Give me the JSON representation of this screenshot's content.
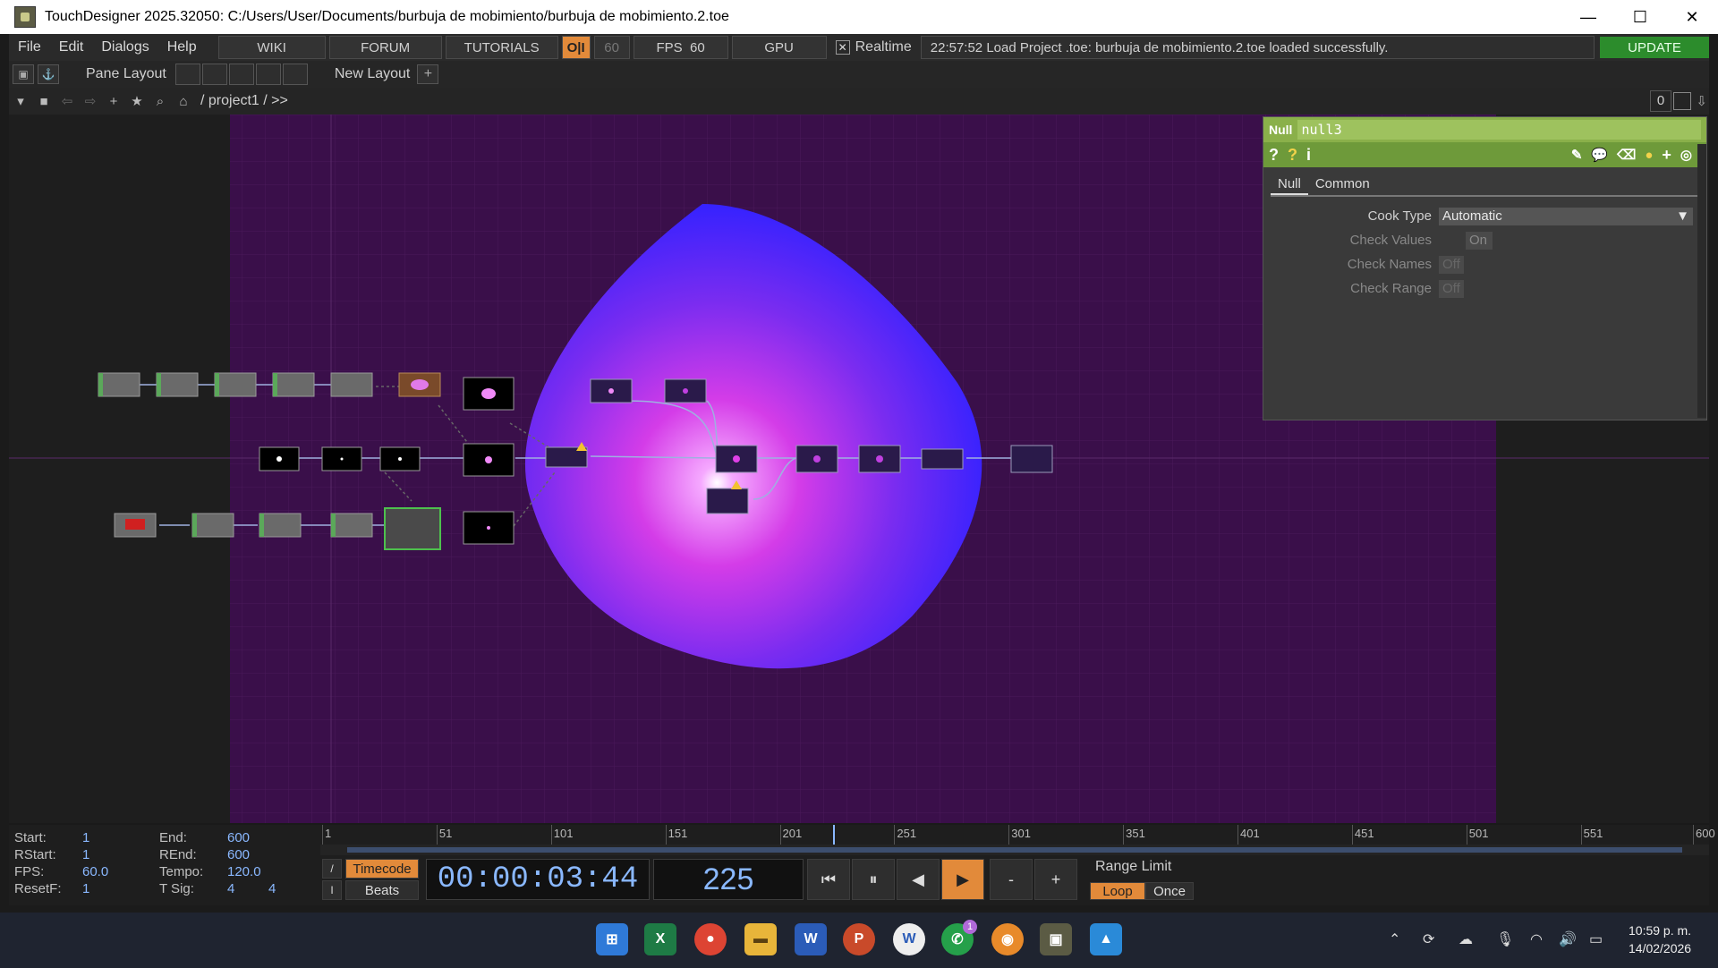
{
  "window": {
    "title": "TouchDesigner 2025.32050: C:/Users/User/Documents/burbuja de mobimiento/burbuja de mobimiento.2.toe",
    "minimize": "—",
    "maximize": "☐",
    "close": "✕"
  },
  "menu": {
    "items": [
      "File",
      "Edit",
      "Dialogs",
      "Help"
    ],
    "wiki": "WIKI",
    "forum": "FORUM",
    "tutorials": "TUTORIALS",
    "oi": "O|I",
    "fps_cap": "60",
    "fps_label": "FPS",
    "fps_value": "60",
    "gpu": "GPU",
    "realtime_check": "✕",
    "realtime": "Realtime",
    "status": "22:57:52 Load Project .toe: burbuja de mobimiento.2.toe loaded successfully.",
    "update": "UPDATE"
  },
  "pane": {
    "pane_layout": "Pane Layout",
    "new_layout": "New Layout",
    "add": "+"
  },
  "path": {
    "text": "/ project1 / >>",
    "counter": "0"
  },
  "params": {
    "type": "Null",
    "name": "null3",
    "tabs": [
      "Null",
      "Common"
    ],
    "cook_type_label": "Cook Type",
    "cook_type_value": "Automatic",
    "check_values_label": "Check Values",
    "check_values_value": "On",
    "check_names_label": "Check Names",
    "check_names_value": "Off",
    "check_range_label": "Check Range",
    "check_range_value": "Off"
  },
  "timeline": {
    "start_label": "Start:",
    "start": "1",
    "end_label": "End:",
    "end": "600",
    "rstart_label": "RStart:",
    "rstart": "1",
    "rend_label": "REnd:",
    "rend": "600",
    "fps_label": "FPS:",
    "fps": "60.0",
    "tempo_label": "Tempo:",
    "tempo": "120.0",
    "resetf_label": "ResetF:",
    "resetf": "1",
    "tsig_label": "T Sig:",
    "tsig_a": "4",
    "tsig_b": "4",
    "ticks": [
      "1",
      "51",
      "101",
      "151",
      "201",
      "251",
      "301",
      "351",
      "401",
      "451",
      "501",
      "551",
      "600"
    ],
    "timecode_btn": "Timecode",
    "beats_btn": "Beats",
    "timecode": "00:00:03:44",
    "frame": "225",
    "frame_fraction": 0.373,
    "minus": "-",
    "plus": "+",
    "range_limit": "Range Limit",
    "loop": "Loop",
    "once": "Once"
  },
  "taskbar": {
    "time": "10:59 p. m.",
    "date": "14/02/2026",
    "whatsapp_badge": "1"
  },
  "colors": {
    "accent_orange": "#e28a3a",
    "param_green": "#8ab04a",
    "update_green": "#2c8c2c",
    "bubble_magenta": "#e040e8",
    "bubble_blue": "#3a2cff"
  }
}
